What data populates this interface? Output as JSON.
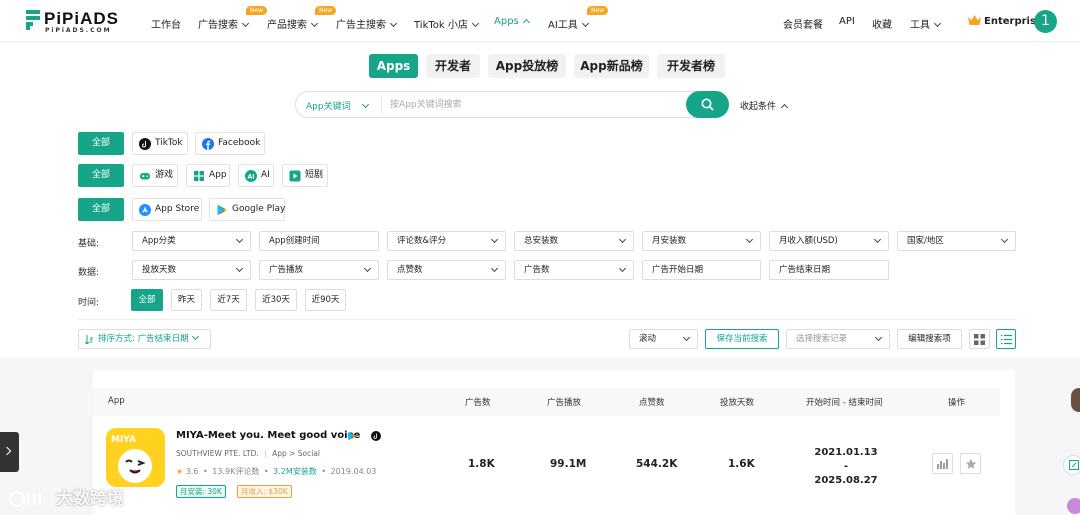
{
  "brand": {
    "name": "PiPiADS",
    "sub": "PiPiADS.COM"
  },
  "nav": {
    "items": [
      {
        "label": "工作台"
      },
      {
        "label": "广告搜索",
        "badge": "New"
      },
      {
        "label": "产品搜索",
        "badge": "New"
      },
      {
        "label": "广告主搜索"
      },
      {
        "label": "TikTok 小店"
      },
      {
        "label": "Apps"
      },
      {
        "label": "AI工具",
        "badge": "New"
      }
    ],
    "right": [
      "会员套餐",
      "API",
      "收藏",
      "工具"
    ],
    "plan": "Enterprise",
    "avatar": "1"
  },
  "tabs": [
    "Apps",
    "开发者",
    "App投放榜",
    "App新品榜",
    "开发者榜"
  ],
  "search": {
    "type": "App关键词",
    "placeholder": "按App关键词搜索",
    "collapse": "收起条件"
  },
  "filters": {
    "all": "全部",
    "platforms": [
      "TikTok",
      "Facebook"
    ],
    "categories": [
      "游戏",
      "App",
      "AI",
      "短剧"
    ],
    "stores": [
      "App Store",
      "Google Play"
    ],
    "basic_label": "基础:",
    "basic": [
      "App分类",
      "App创建时间",
      "评论数&评分",
      "总安装数",
      "月安装数",
      "月收入额(USD)",
      "国家/地区"
    ],
    "data_label": "数据:",
    "data": [
      "投放天数",
      "广告播放",
      "点赞数",
      "广告数",
      "广告开始日期",
      "广告结束日期"
    ],
    "time_label": "时间:",
    "time": [
      "全部",
      "昨天",
      "近7天",
      "近30天",
      "近90天"
    ]
  },
  "toolbar": {
    "sort": "排序方式: 广告结束日期",
    "scroll": "滚动",
    "save": "保存当前搜索",
    "history": "选择搜索记录",
    "edit": "编辑搜索项"
  },
  "table": {
    "headers": [
      "App",
      "广告数",
      "广告播放",
      "点赞数",
      "投放天数",
      "开始时间 - 结束时间",
      "操作"
    ],
    "rows": [
      {
        "name": "MIYA-Meet you. Meet good voice",
        "developer": "SOUTHVIEW PTE. LTD.",
        "category": "App > Social",
        "rating": "3.6",
        "reviews": "13.9K评论数",
        "installs": "3.2M安装数",
        "date": "2019.04.03",
        "monthly_installs": "月安装: 30K",
        "monthly_revenue": "月收入: $30K",
        "ads": "1.8K",
        "plays": "99.1M",
        "likes": "544.2K",
        "days": "1.6K",
        "start": "2021.01.13",
        "dash": "-",
        "end": "2025.08.27"
      }
    ]
  },
  "watermark": "大数跨境",
  "colors": {
    "accent": "#17a589",
    "badge": "#f5a623",
    "install": "#17a589",
    "revenue": "#e6a23c"
  }
}
